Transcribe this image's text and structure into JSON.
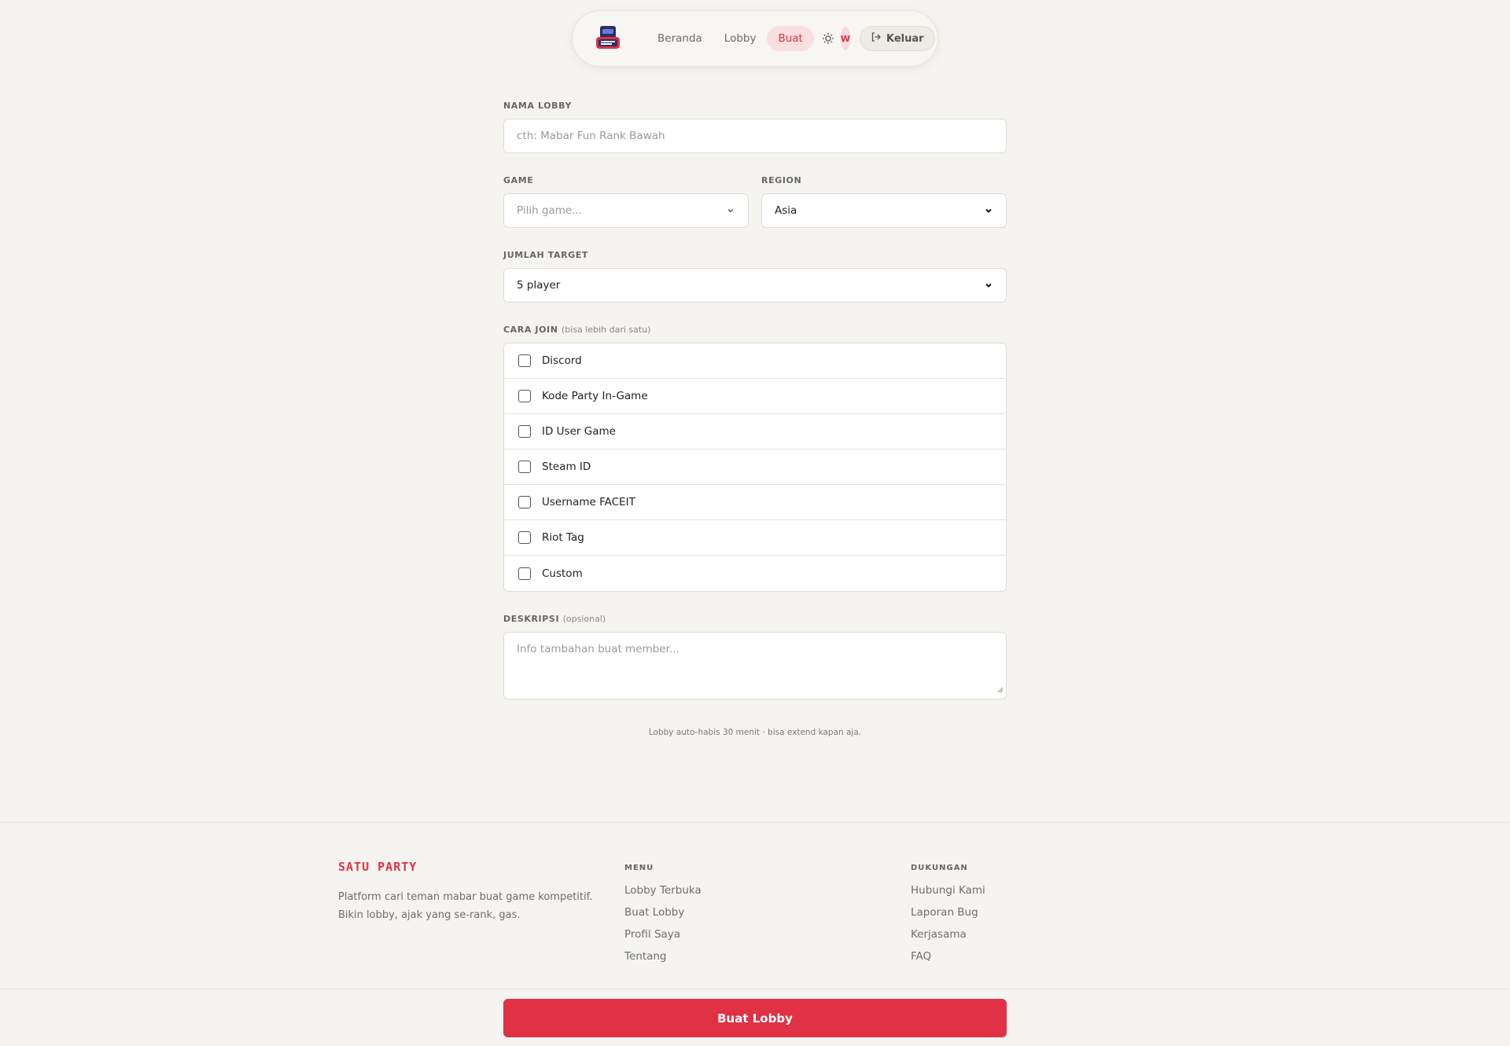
{
  "nav": {
    "logo_alt": "Satu Party logo",
    "links": [
      {
        "label": "Beranda",
        "active": false
      },
      {
        "label": "Lobby",
        "active": false
      },
      {
        "label": "Buat",
        "active": true
      }
    ],
    "avatar_initial": "W",
    "logout_label": "Keluar"
  },
  "form": {
    "lobby_name": {
      "label": "NAMA LOBBY",
      "placeholder": "cth: Mabar Fun Rank Bawah",
      "value": ""
    },
    "game": {
      "label": "GAME",
      "placeholder": "Pilih game..."
    },
    "region": {
      "label": "REGION",
      "value": "Asia"
    },
    "target": {
      "label": "JUMLAH TARGET",
      "value": "5 player"
    },
    "join": {
      "label": "CARA JOIN",
      "hint": "(bisa lebih dari satu)",
      "options": [
        "Discord",
        "Kode Party In-Game",
        "ID User Game",
        "Steam ID",
        "Username FACEIT",
        "Riot Tag",
        "Custom"
      ]
    },
    "description": {
      "label": "DESKRIPSI",
      "hint": "(opsional)",
      "placeholder": "Info tambahan buat member..."
    },
    "note": "Lobby auto-habis 30 menit · bisa extend kapan aja.",
    "submit_label": "Buat Lobby"
  },
  "footer": {
    "brand": "SATU PARTY",
    "tagline_1": "Platform cari teman mabar buat game kompetitif.",
    "tagline_2": "Bikin lobby, ajak yang se-rank, gas.",
    "menu": {
      "title": "MENU",
      "links": [
        "Lobby Terbuka",
        "Buat Lobby",
        "Profil Saya",
        "Tentang"
      ]
    },
    "support": {
      "title": "DUKUNGAN",
      "links": [
        "Hubungi Kami",
        "Laporan Bug",
        "Kerjasama",
        "FAQ"
      ]
    }
  },
  "colors": {
    "accent": "#e03145",
    "background": "#f5f4f0"
  }
}
